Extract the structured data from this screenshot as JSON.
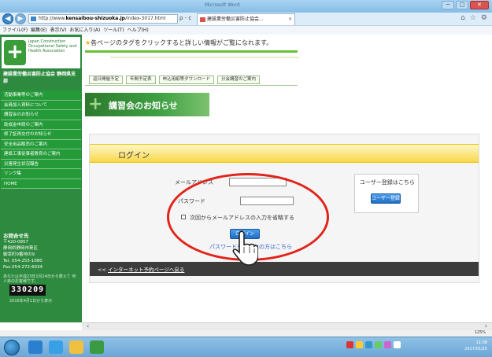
{
  "browser": {
    "address_prefix": "http://www.",
    "address_domain": "kensaibou-shizuoka.jp",
    "address_suffix": "/index-3017.html",
    "address_controls": "ρ - c",
    "tab_title": "建設業労働災害防止協会...",
    "tab_close": "×",
    "window_title": "Microsoft Word",
    "min": "─",
    "max": "▢",
    "close": "✕",
    "menu": [
      "ファイル(F)",
      "編集(E)",
      "表示(V)",
      "お気に入り(A)",
      "ツール(T)",
      "ヘルプ(H)"
    ]
  },
  "sidebar": {
    "logo_text": "Japan Construction Occupational Safety and Health Association",
    "subtitle": "建設業労働災害防止協会 静岡県支部",
    "items": [
      "活動事業等のご案内",
      "会員加入資料について",
      "講習会のお知らせ",
      "助成金申請のご案内",
      "修了証再交付のお知らせ",
      "安全用品販売のご案内",
      "建設工事従事者教育のご案内",
      "災害発生状況報告",
      "リンク集",
      "HOME"
    ],
    "contact": {
      "head": "お問合せ先",
      "zip": "〒420-0857",
      "addr1": "静岡県静岡市葵区",
      "addr2": "御幸町9番地の9",
      "tel": "Tel. 054-255-1080",
      "fax": "Fax.054-272-6034"
    },
    "counter_label": "あなたは平成23年1月24日から数えて 何人目のお客様です。",
    "counter": "330209",
    "counter_date": "2016年4月1日から表示"
  },
  "main": {
    "notice": "各ページのタグをクリックすると詳しい情報がご覧になれます。",
    "tabs": [
      "返日開催予定",
      "年間予定表",
      "申込用紙等ダウンロード",
      "分会講習のご案内"
    ],
    "banner": "講習会のお知らせ",
    "login": {
      "title": "ログイン",
      "email_label": "メールアドレス",
      "password_label": "パスワード",
      "remember_label": "次回からメールアドレスの入力を省略する",
      "login_button": "ログイン",
      "forgot": "パスワードをお忘れの方はこちら",
      "register_title": "ユーザー登録はこちら",
      "register_button": "ユーザー登録",
      "back_prefix": "<<",
      "back_link": "インターネット予約ページへ戻る"
    }
  },
  "status": {
    "zoom": "125%"
  },
  "taskbar": {
    "time": "11:08",
    "date": "2017/01/25"
  },
  "colors": {
    "sidebar": "#2d8a3e",
    "accent_yellow": "#f8d84a",
    "annotation_red": "#e2231a",
    "button_blue": "#1f6fc6"
  }
}
